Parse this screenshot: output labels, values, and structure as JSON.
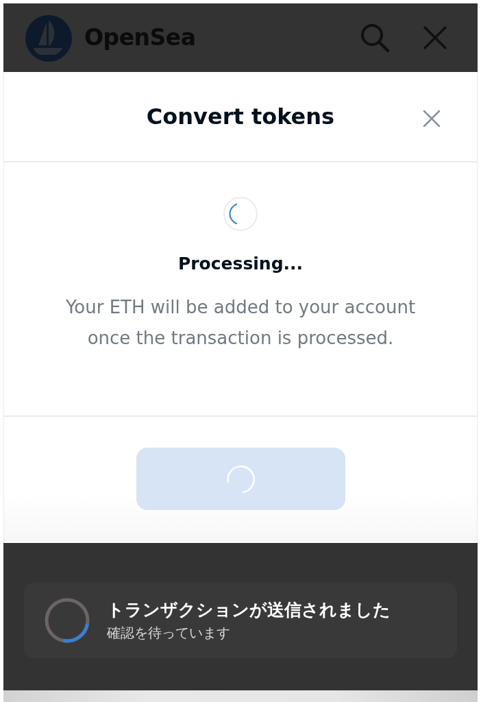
{
  "header": {
    "brand": "OpenSea"
  },
  "modal": {
    "title": "Convert tokens",
    "status": {
      "title": "Processing...",
      "message": "Your ETH will be added to your account once the transaction is processed."
    },
    "submit_button": {
      "disabled": true,
      "loading": true
    }
  },
  "toast": {
    "title": "トランザクションが送信されました",
    "subtitle": "確認を待っています"
  }
}
